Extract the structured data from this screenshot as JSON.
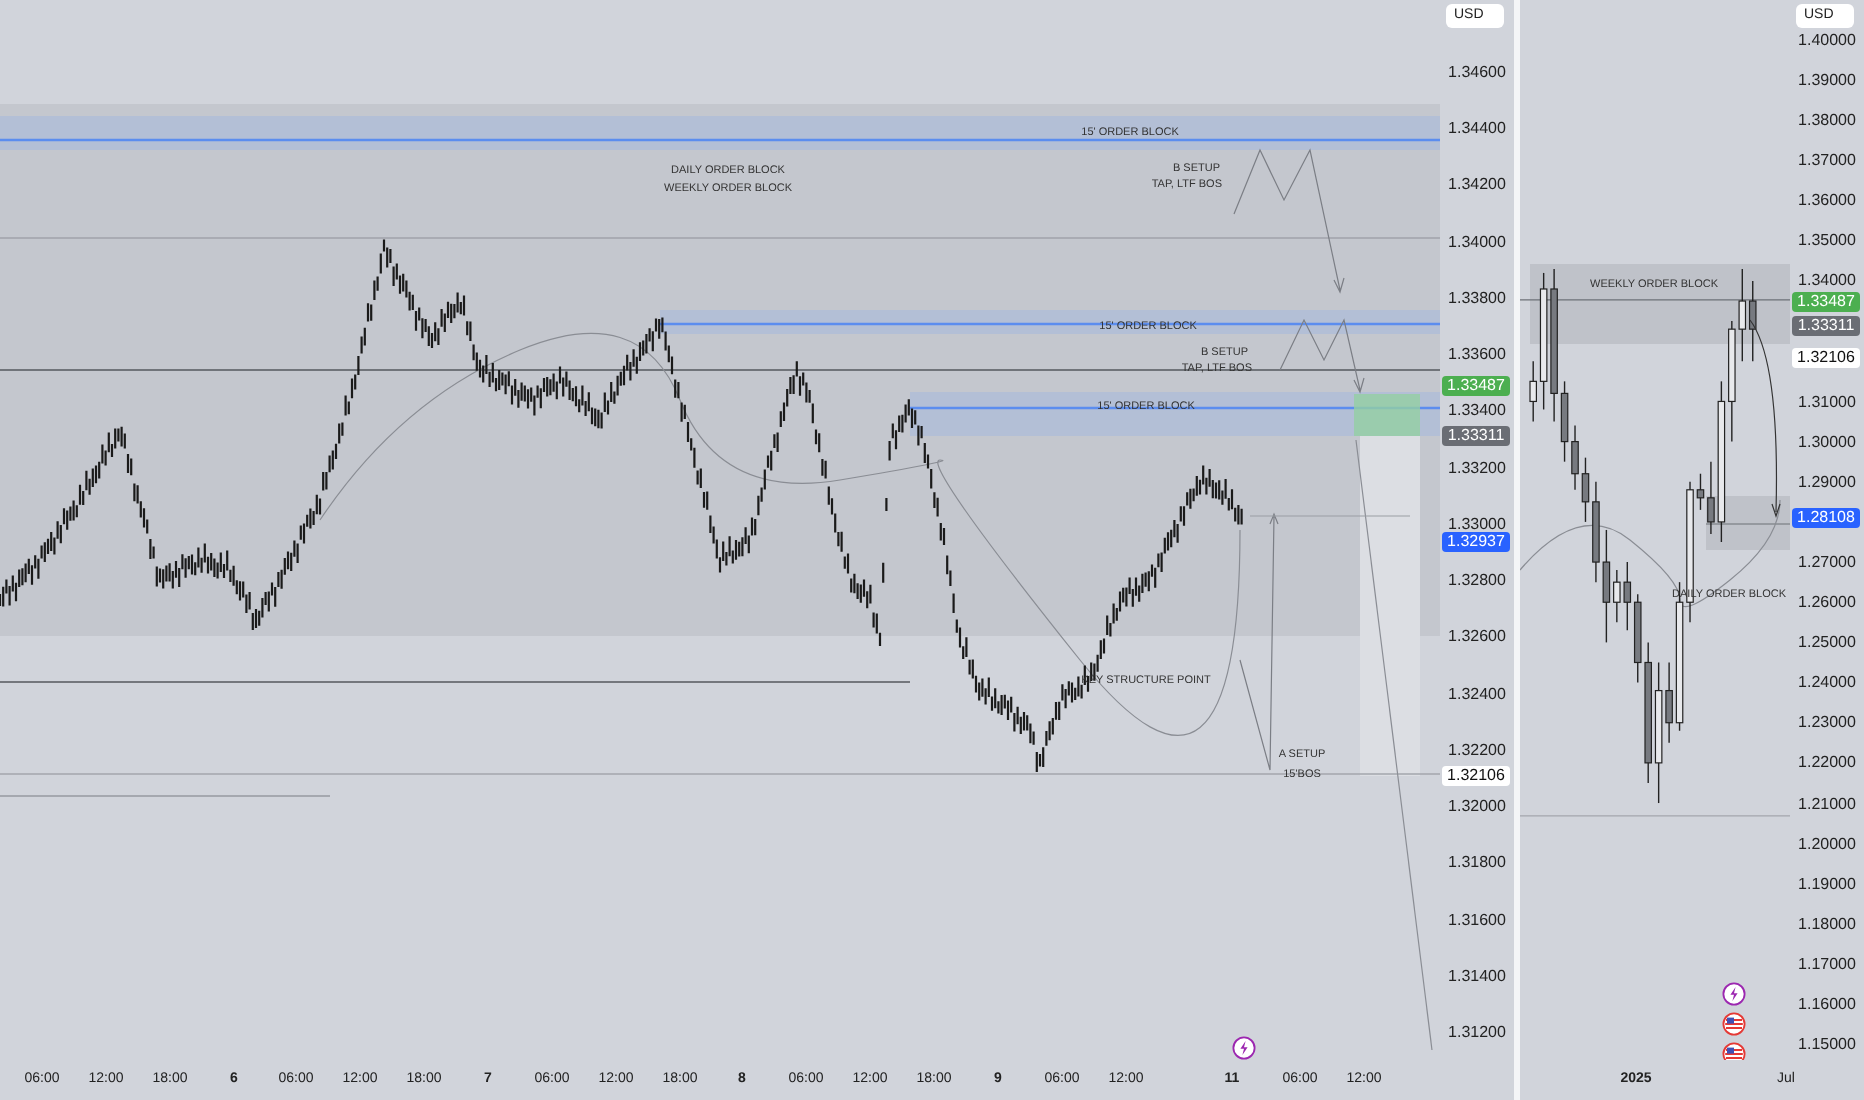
{
  "left_chart": {
    "currency": "USD",
    "price_axis": [
      "1.34600",
      "1.34400",
      "1.34200",
      "1.34000",
      "1.33800",
      "1.33600",
      "1.33400",
      "1.33200",
      "1.33000",
      "1.32800",
      "1.32600",
      "1.32400",
      "1.32200",
      "1.32000",
      "1.31800",
      "1.31600",
      "1.31400",
      "1.31200"
    ],
    "price_tags": [
      {
        "text": "1.33487",
        "color": "#4caf50"
      },
      {
        "text": "1.33311",
        "color": "#6a6d74"
      },
      {
        "text": "1.32937",
        "color": "#2962ff"
      },
      {
        "text": "1.32106",
        "color": "#ffffff"
      }
    ],
    "time_axis": [
      {
        "text": "06:00",
        "kind": "time"
      },
      {
        "text": "12:00",
        "kind": "time"
      },
      {
        "text": "18:00",
        "kind": "time"
      },
      {
        "text": "6",
        "kind": "day"
      },
      {
        "text": "06:00",
        "kind": "time"
      },
      {
        "text": "12:00",
        "kind": "time"
      },
      {
        "text": "18:00",
        "kind": "time"
      },
      {
        "text": "7",
        "kind": "day"
      },
      {
        "text": "06:00",
        "kind": "time"
      },
      {
        "text": "12:00",
        "kind": "time"
      },
      {
        "text": "18:00",
        "kind": "time"
      },
      {
        "text": "8",
        "kind": "day"
      },
      {
        "text": "06:00",
        "kind": "time"
      },
      {
        "text": "12:00",
        "kind": "time"
      },
      {
        "text": "18:00",
        "kind": "time"
      },
      {
        "text": "9",
        "kind": "day"
      },
      {
        "text": "06:00",
        "kind": "time"
      },
      {
        "text": "12:00",
        "kind": "time"
      },
      {
        "text": "11",
        "kind": "day"
      },
      {
        "text": "06:00",
        "kind": "time"
      },
      {
        "text": "12:00",
        "kind": "time"
      }
    ],
    "annotations": [
      "15' ORDER BLOCK",
      "DAILY ORDER BLOCK",
      "WEEKLY ORDER BLOCK",
      "B SETUP",
      "TAP, LTF BOS",
      "15' ORDER BLOCK",
      "B SETUP",
      "TAP, LTF BOS",
      "15' ORDER BLOCK",
      "KEY STRUCTURE POINT",
      "A SETUP",
      "15'BOS"
    ]
  },
  "right_chart": {
    "currency": "USD",
    "price_tags": [
      {
        "text": "1.33487",
        "color": "#4caf50"
      },
      {
        "text": "1.33311",
        "color": "#6a6d74"
      },
      {
        "text": "1.32106",
        "color": "#ffffff"
      },
      {
        "text": "1.28108",
        "color": "#2962ff"
      }
    ],
    "time_axis": [
      {
        "text": "2025",
        "kind": "day"
      },
      {
        "text": "Jul",
        "kind": "time"
      }
    ],
    "annotations": [
      "WEEKLY ORDER BLOCK",
      "DAILY ORDER BLOCK"
    ],
    "chart_data": {
      "type": "candlestick",
      "categories": [
        null,
        null,
        null,
        null,
        null,
        null,
        null,
        null,
        null,
        null,
        null,
        null,
        null,
        null,
        null,
        null,
        null,
        null,
        null,
        null,
        null,
        null
      ],
      "yticks": [
        {
          "value": 1.4,
          "label": "1.40000"
        },
        {
          "value": 1.39,
          "label": "1.39000"
        },
        {
          "value": 1.38,
          "label": "1.38000"
        },
        {
          "value": 1.37,
          "label": "1.37000"
        },
        {
          "value": 1.36,
          "label": "1.36000"
        },
        {
          "value": 1.35,
          "label": "1.35000"
        },
        {
          "value": 1.34,
          "label": "1.34000"
        },
        {
          "value": 1.31,
          "label": "1.31000"
        },
        {
          "value": 1.3,
          "label": "1.30000"
        },
        {
          "value": 1.29,
          "label": "1.29000"
        },
        {
          "value": 1.27,
          "label": "1.27000"
        },
        {
          "value": 1.26,
          "label": "1.26000"
        },
        {
          "value": 1.25,
          "label": "1.25000"
        },
        {
          "value": 1.24,
          "label": "1.24000"
        },
        {
          "value": 1.23,
          "label": "1.23000"
        },
        {
          "value": 1.22,
          "label": "1.22000"
        },
        {
          "value": 1.21,
          "label": "1.21000"
        },
        {
          "value": 1.2,
          "label": "1.20000"
        },
        {
          "value": 1.19,
          "label": "1.19000"
        },
        {
          "value": 1.18,
          "label": "1.18000"
        },
        {
          "value": 1.17,
          "label": "1.17000"
        },
        {
          "value": 1.16,
          "label": "1.16000"
        },
        {
          "value": 1.15,
          "label": "1.15000"
        }
      ],
      "ohlc": [
        [
          1.31,
          1.32,
          1.305,
          1.315
        ],
        [
          1.315,
          1.342,
          1.308,
          1.338
        ],
        [
          1.338,
          1.343,
          1.305,
          1.312
        ],
        [
          1.312,
          1.315,
          1.295,
          1.3
        ],
        [
          1.3,
          1.304,
          1.288,
          1.292
        ],
        [
          1.292,
          1.296,
          1.28,
          1.285
        ],
        [
          1.285,
          1.29,
          1.265,
          1.27
        ],
        [
          1.27,
          1.278,
          1.25,
          1.26
        ],
        [
          1.26,
          1.268,
          1.255,
          1.265
        ],
        [
          1.265,
          1.27,
          1.253,
          1.26
        ],
        [
          1.26,
          1.262,
          1.24,
          1.245
        ],
        [
          1.245,
          1.25,
          1.215,
          1.22
        ],
        [
          1.22,
          1.245,
          1.21,
          1.238
        ],
        [
          1.238,
          1.245,
          1.225,
          1.23
        ],
        [
          1.23,
          1.265,
          1.228,
          1.26
        ],
        [
          1.26,
          1.29,
          1.255,
          1.288
        ],
        [
          1.288,
          1.292,
          1.283,
          1.286
        ],
        [
          1.286,
          1.295,
          1.277,
          1.28
        ],
        [
          1.28,
          1.315,
          1.275,
          1.31
        ],
        [
          1.31,
          1.33,
          1.3,
          1.328
        ],
        [
          1.328,
          1.343,
          1.32,
          1.335
        ],
        [
          1.335,
          1.34,
          1.32,
          1.328
        ]
      ],
      "ref_lines": [
        {
          "axis": "y",
          "value": 1.3353,
          "color": "#6d7077"
        },
        {
          "axis": "y",
          "value": 1.2068,
          "color": "#a3a6ad"
        }
      ],
      "ylim": [
        1.15,
        1.4
      ]
    }
  }
}
